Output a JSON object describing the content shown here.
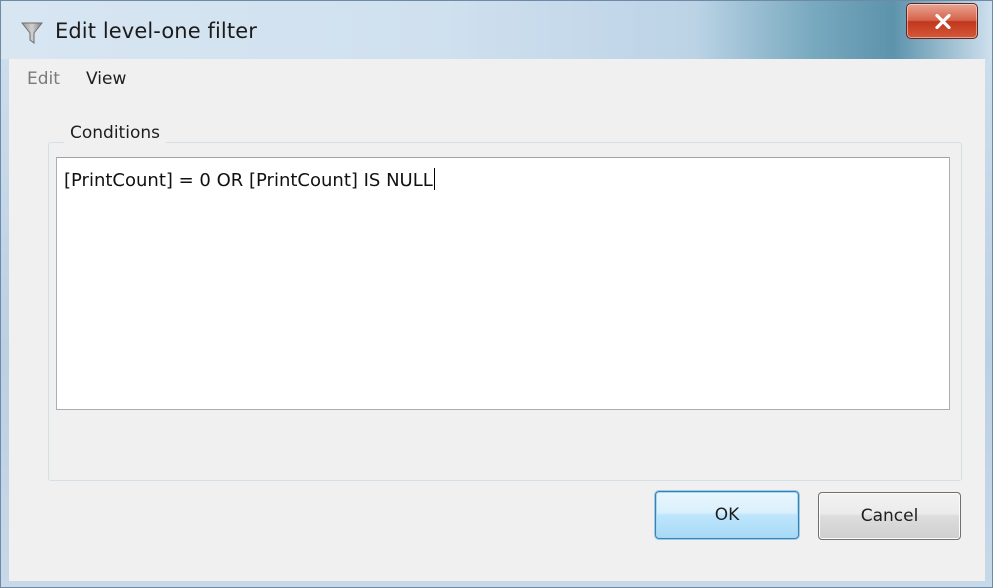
{
  "window": {
    "title": "Edit level-one filter",
    "title_icon": "filter-funnel-icon",
    "close_icon": "close-icon"
  },
  "menu": {
    "items": [
      {
        "label": "Edit",
        "enabled": false
      },
      {
        "label": "View",
        "enabled": true
      }
    ]
  },
  "conditions": {
    "group_label": "Conditions",
    "value": "[PrintCount] = 0 OR [PrintCount] IS NULL"
  },
  "buttons": {
    "ok_label": "OK",
    "cancel_label": "Cancel"
  },
  "colors": {
    "close_button": "#c7432a",
    "default_button_border": "#3c7fb1"
  }
}
